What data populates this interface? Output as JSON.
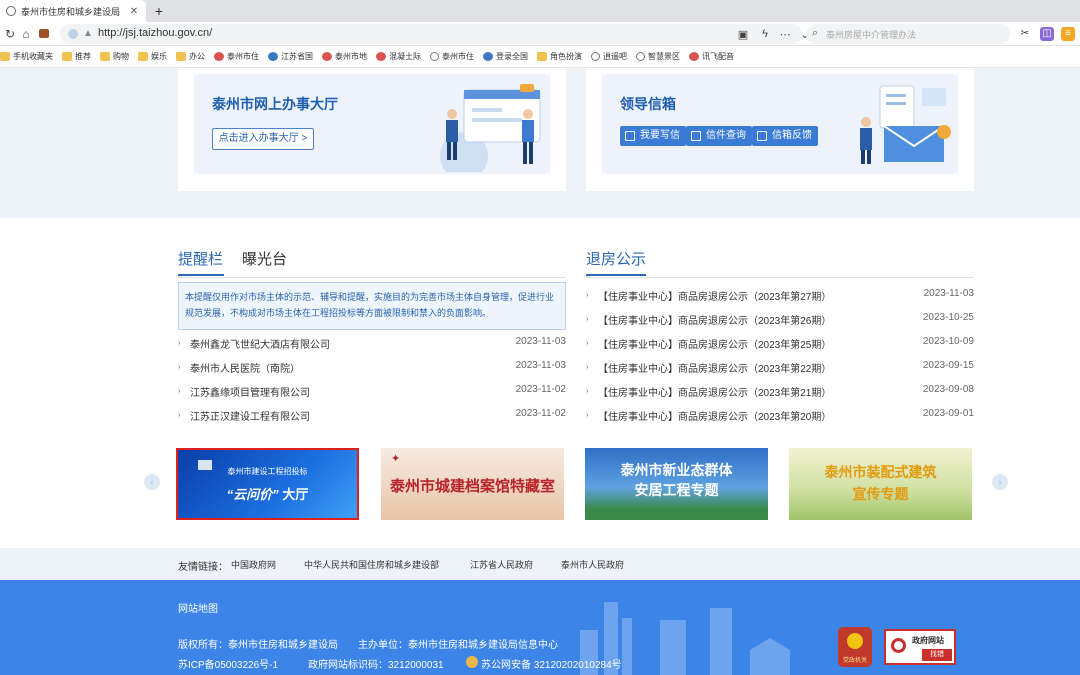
{
  "browser": {
    "tab_title": "泰州市住房和城乡建设局",
    "tab_close": "✕",
    "new_tab": "+",
    "url": "http://jsj.taizhou.gov.cn/",
    "search_placeholder": "泰州房屋中介管理办法"
  },
  "bookmarks": [
    {
      "label": "手机收藏夹",
      "icon": "folder"
    },
    {
      "label": "推荐",
      "icon": "folder"
    },
    {
      "label": "购物",
      "icon": "folder"
    },
    {
      "label": "娱乐",
      "icon": "folder"
    },
    {
      "label": "办公",
      "icon": "folder"
    },
    {
      "label": "泰州市住",
      "icon": "site"
    },
    {
      "label": "江苏省国",
      "icon": "site2"
    },
    {
      "label": "泰州市地",
      "icon": "site"
    },
    {
      "label": "混凝土际",
      "icon": "site"
    },
    {
      "label": "泰州市住",
      "icon": "globe"
    },
    {
      "label": "登录全国",
      "icon": "site2"
    },
    {
      "label": "角色扮演",
      "icon": "folder"
    },
    {
      "label": "逍遥吧",
      "icon": "globe"
    },
    {
      "label": "智慧景区",
      "icon": "globe"
    },
    {
      "label": "讯飞配音",
      "icon": "site"
    }
  ],
  "cards": {
    "hall_title": "泰州市网上办事大厅",
    "hall_button": "点击进入办事大厅 >",
    "mail_title": "领导信箱",
    "mail_buttons": [
      "我要写信",
      "信件查询",
      "信箱反馈"
    ]
  },
  "reminder": {
    "tab_active": "提醒栏",
    "tab_other": "曝光台",
    "notice": "本提醒仅用作对市场主体的示范、辅导和提醒，实施目的为完善市场主体自身管理，促进行业规范发展，不构成对市场主体在工程招投标等方面被限制和禁入的负面影响。",
    "items": [
      {
        "name": "泰州鑫龙飞世纪大酒店有限公司",
        "date": "2023-11-03"
      },
      {
        "name": "泰州市人民医院（南院）",
        "date": "2023-11-03"
      },
      {
        "name": "江苏鑫缘项目管理有限公司",
        "date": "2023-11-02"
      },
      {
        "name": "江苏正汉建设工程有限公司",
        "date": "2023-11-02"
      }
    ]
  },
  "refund": {
    "title": "退房公示",
    "items": [
      {
        "name": "【住房事业中心】商品房退房公示（2023年第27期）",
        "date": "2023-11-03"
      },
      {
        "name": "【住房事业中心】商品房退房公示（2023年第26期）",
        "date": "2023-10-25"
      },
      {
        "name": "【住房事业中心】商品房退房公示（2023年第25期）",
        "date": "2023-10-09"
      },
      {
        "name": "【住房事业中心】商品房退房公示（2023年第22期）",
        "date": "2023-09-15"
      },
      {
        "name": "【住房事业中心】商品房退房公示（2023年第21期）",
        "date": "2023-09-08"
      },
      {
        "name": "【住房事业中心】商品房退房公示（2023年第20期）",
        "date": "2023-09-01"
      }
    ]
  },
  "banners": {
    "b1_small": "泰州市建设工程招投标",
    "b1_big_a": "“云问价”",
    "b1_big_b": "大厅",
    "b2": "泰州市城建档案馆特藏室",
    "b3_line1": "泰州市新业态群体",
    "b3_line2": "安居工程专题",
    "b4_line1": "泰州市装配式建筑",
    "b4_line2": "宣传专题",
    "prev": "‹",
    "next": "›"
  },
  "friend_links": {
    "label": "友情链接：",
    "items": [
      "中国政府网",
      "中华人民共和国住房和城乡建设部",
      "江苏省人民政府",
      "泰州市人民政府"
    ]
  },
  "footer": {
    "sitemap": "网站地图",
    "copyright": "版权所有：泰州市住房和城乡建设局",
    "host": "主办单位：泰州市住房和城乡建设局信息中心",
    "icp": "苏ICP备05003226号-1",
    "site_code": "政府网站标识码：3212000031",
    "police": "苏公网安备 32120202010284号",
    "party_badge": "党政机关",
    "gov_badge_title": "政府网站",
    "gov_badge_sub": "找错"
  },
  "colors": {
    "accent": "#2c68b5",
    "footer_bg": "#3d84e8",
    "page_bg": "#eef3f9",
    "selected_border": "#e02020"
  }
}
